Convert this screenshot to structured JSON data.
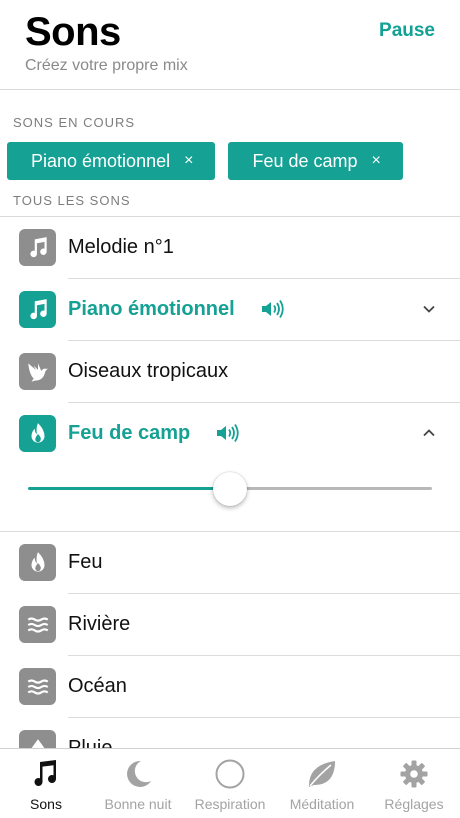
{
  "header": {
    "title": "Sons",
    "subtitle": "Créez votre propre mix",
    "pause_label": "Pause"
  },
  "current_section": {
    "label": "SONS EN COURS",
    "chips": [
      {
        "label": "Piano émotionnel",
        "close": "×"
      },
      {
        "label": "Feu de camp",
        "close": "×"
      }
    ]
  },
  "all_section": {
    "label": "TOUS LES SONS",
    "items": [
      {
        "label": "Melodie n°1",
        "icon": "music-note-icon",
        "active": false
      },
      {
        "label": "Piano émotionnel",
        "icon": "music-note-icon",
        "active": true,
        "playing": true,
        "expanded": false
      },
      {
        "label": "Oiseaux tropicaux",
        "icon": "bird-icon",
        "active": false
      },
      {
        "label": "Feu de camp",
        "icon": "flame-icon",
        "active": true,
        "playing": true,
        "expanded": true
      },
      {
        "label": "Feu",
        "icon": "flame-icon",
        "active": false
      },
      {
        "label": "Rivière",
        "icon": "waves-icon",
        "active": false
      },
      {
        "label": "Océan",
        "icon": "waves-icon",
        "active": false
      },
      {
        "label": "Pluie",
        "icon": "rain-icon",
        "active": false
      }
    ],
    "volume": 0.5
  },
  "tabbar": {
    "tabs": [
      {
        "label": "Sons",
        "icon": "music-note-icon",
        "active": true
      },
      {
        "label": "Bonne nuit",
        "icon": "moon-icon",
        "active": false
      },
      {
        "label": "Respiration",
        "icon": "circle-icon",
        "active": false
      },
      {
        "label": "Méditation",
        "icon": "leaf-icon",
        "active": false
      },
      {
        "label": "Réglages",
        "icon": "gear-icon",
        "active": false
      }
    ]
  },
  "colors": {
    "accent": "#15a194",
    "icon_gray": "#8e8e8e",
    "text": "#111111",
    "muted": "#a3a3a3"
  }
}
